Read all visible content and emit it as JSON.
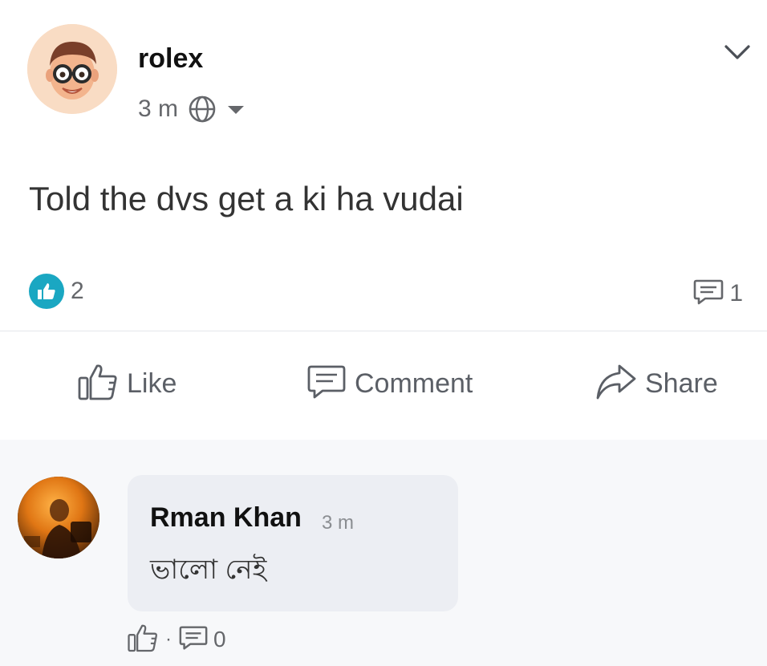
{
  "post": {
    "author": "rolex",
    "time": "3 m",
    "privacy_icon": "globe-icon",
    "text": "Told the dvs get a ki ha vudai",
    "likes_count": "2",
    "comments_count": "1"
  },
  "actions": {
    "like_label": "Like",
    "comment_label": "Comment",
    "share_label": "Share"
  },
  "comment": {
    "author": "Rman Khan",
    "time": "3 m",
    "text": "ভালো নেই",
    "separator": "·",
    "reply_count": "0"
  },
  "colors": {
    "like_badge": "#1aa7c2",
    "icon_gray": "#65676b",
    "comment_section_bg": "#f7f8fa",
    "bubble_bg": "#eceef3"
  }
}
